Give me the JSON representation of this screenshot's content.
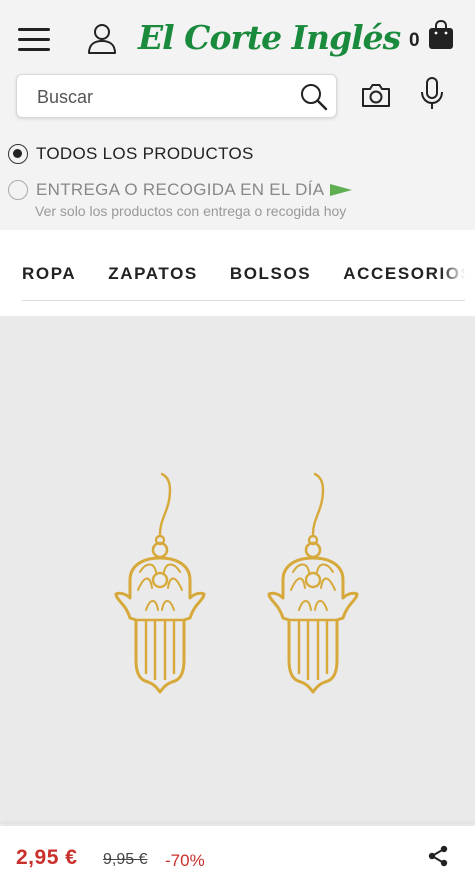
{
  "header": {
    "logo_text": "El Corte Inglés",
    "cart_count": "0",
    "icons": [
      "menu-icon",
      "user-icon",
      "shopping-bag-icon"
    ]
  },
  "search": {
    "placeholder": "Buscar",
    "icons": [
      "search-icon",
      "camera-icon",
      "microphone-icon"
    ]
  },
  "filters": {
    "option_all": "TODOS LOS PRODUCTOS",
    "option_all_selected": true,
    "option_delivery": "ENTREGA O RECOGIDA EN EL DÍA",
    "option_delivery_selected": false,
    "option_delivery_sub": "Ver solo los productos con entrega o recogida hoy"
  },
  "categories": {
    "tabs": [
      "ROPA",
      "ZAPATOS",
      "BOLSOS",
      "ACCESORIOS"
    ]
  },
  "product": {
    "image_subject": "gold hamsa hand earrings",
    "price_current": "2,95 €",
    "price_original": "9,95 €",
    "discount": "-70%"
  },
  "colors": {
    "brand_green": "#1a8a3d",
    "price_red": "#c9302c",
    "gold": "#d6a93a"
  }
}
